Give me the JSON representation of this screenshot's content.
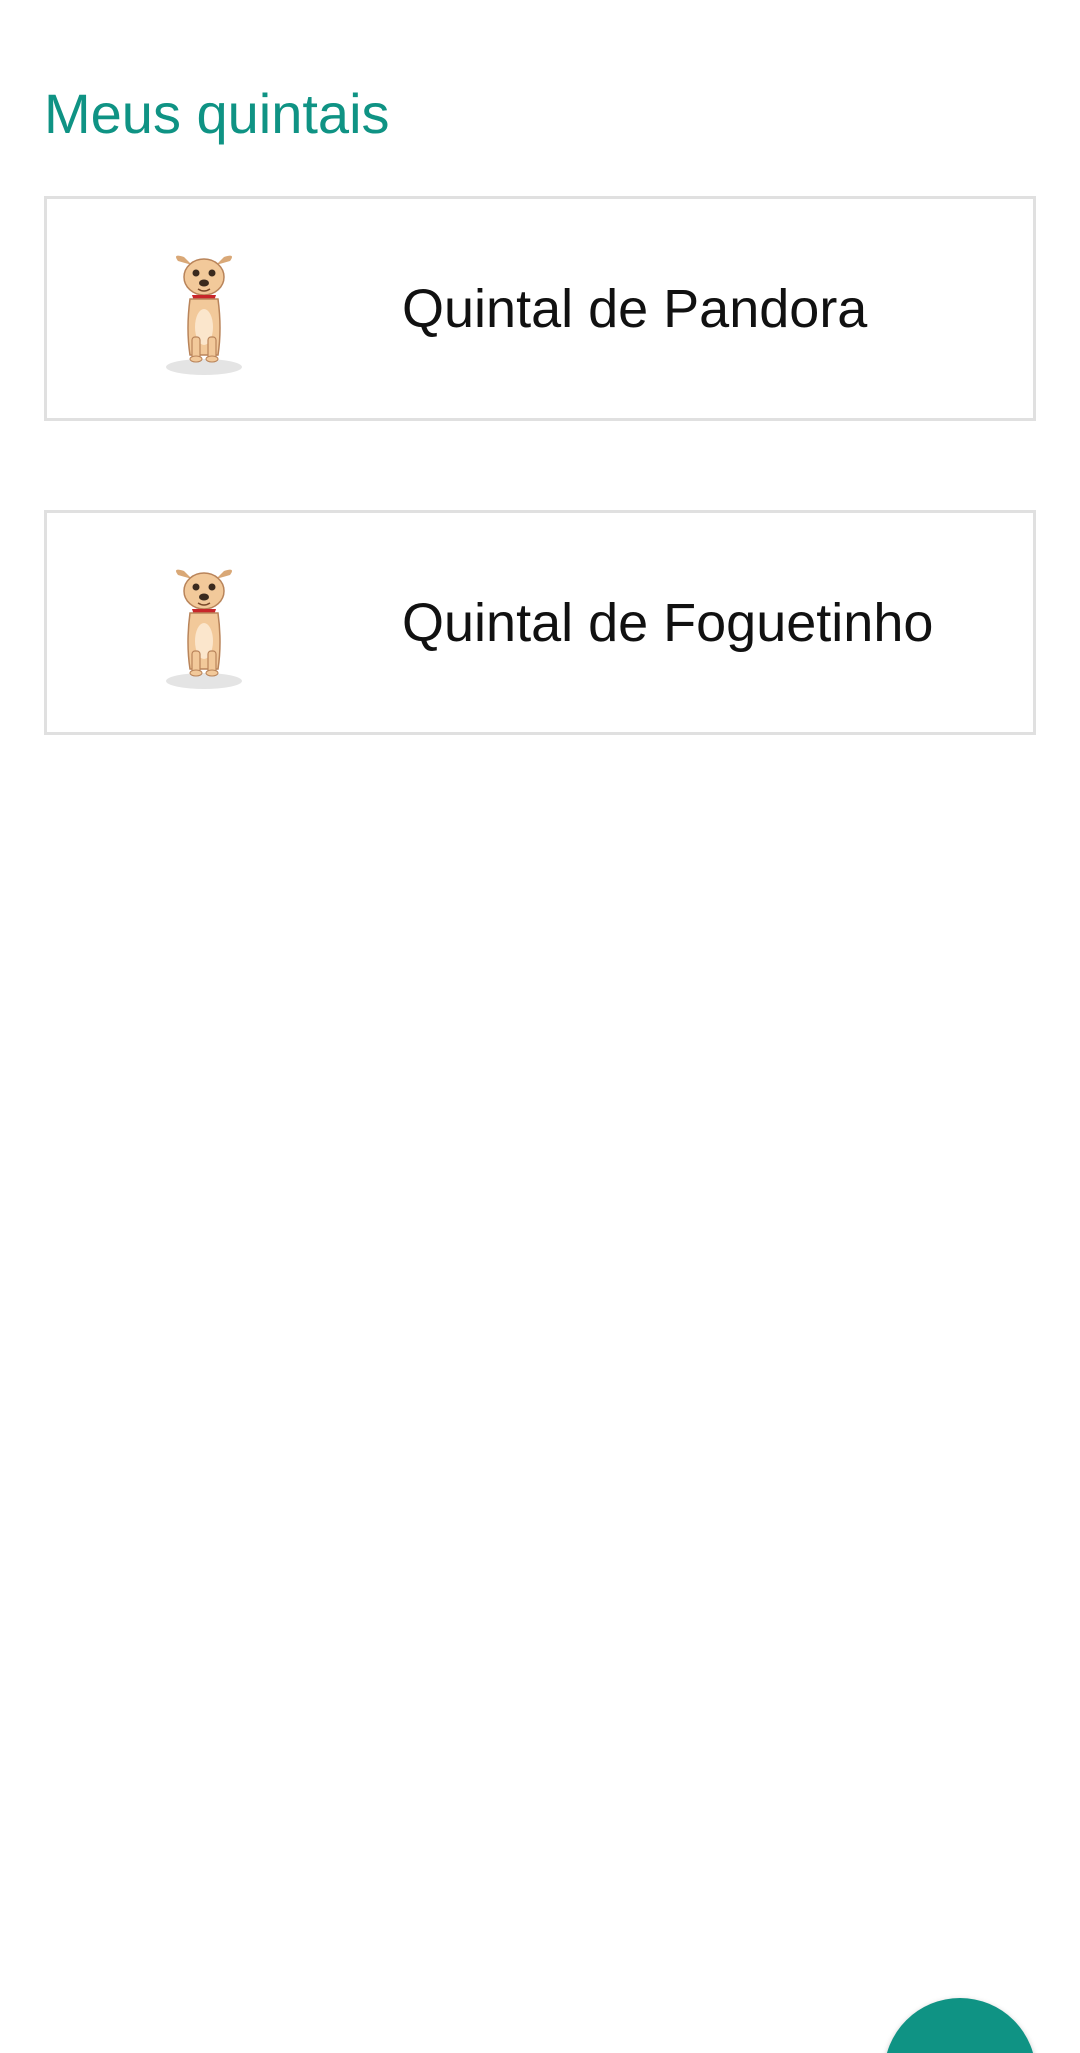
{
  "header": {
    "title": "Meus quintais"
  },
  "yards": [
    {
      "name": "Quintal de Pandora",
      "icon": "dog-icon"
    },
    {
      "name": "Quintal de Foguetinho",
      "icon": "dog-icon"
    }
  ],
  "fab": {
    "icon": "add-icon"
  },
  "colors": {
    "accent": "#0f9384",
    "card_border": "#e0e0e0",
    "text": "#111111",
    "background": "#ffffff"
  }
}
